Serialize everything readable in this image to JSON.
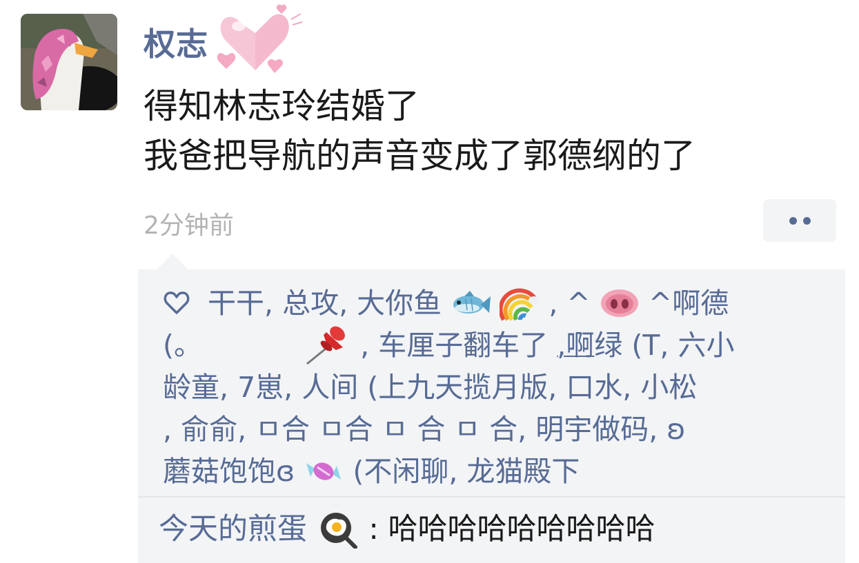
{
  "post": {
    "username": "权志",
    "lines": [
      "得知林志玲结婚了",
      "我爸把导航的声音变成了郭德纲的了"
    ],
    "time": "2分钟前"
  },
  "likes": {
    "row1": {
      "a": "干干, 总攻, 大你鱼",
      "b": ",  ^",
      "c": "^啊德"
    },
    "row2": {
      "a": "(。",
      "b": ", 车厘子翻车了",
      "c": ", ",
      "d": "啊",
      "e": "绿 (T, 六小"
    },
    "row3": {
      "a": "龄童, 7崽, 人间 (上九天揽月版, 口水, 小松"
    },
    "row4": {
      "a": ", 俞俞, ㅁ合 ㅁ合  ㅁ 合   ㅁ 合, 明宇做码, ʚ"
    },
    "row5": {
      "a": "蘑菇饱饱ɞ",
      "b": "(不闲聊, 龙猫殿下"
    }
  },
  "comment": {
    "author": "今天的煎蛋",
    "separator": ": ",
    "text": "哈哈哈哈哈哈哈哈哈"
  },
  "icons": {
    "avatar": "goose-with-scarf",
    "hearts": "pink-hearts-sticker",
    "like": "heart-outline-icon",
    "fish": "fish-emoji",
    "rainbow": "rainbow-emoji",
    "pig": "pig-nose-emoji",
    "pin": "pushpin-emoji",
    "candy": "candy-emoji",
    "egg": "fried-egg-emoji"
  },
  "colors": {
    "name": "#576b95",
    "panel": "#f3f4f6",
    "time": "#b3b3b3",
    "text": "#1a1a1a"
  }
}
